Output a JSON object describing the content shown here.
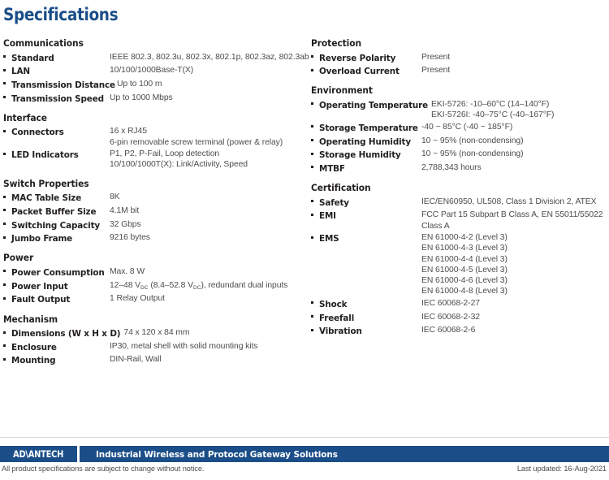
{
  "page": {
    "title": "Specifications",
    "title_color": "#1b4e88"
  },
  "left_column": [
    {
      "title": "Communications",
      "rows": [
        {
          "label": "Standard",
          "values": [
            "IEEE 802.3, 802.3u, 802.3x, 802.1p, 802.3az, 802.3ab"
          ]
        },
        {
          "label": "LAN",
          "values": [
            "10/100/1000Base-T(X)"
          ]
        },
        {
          "label": "Transmission Distance",
          "values": [
            "Up to 100 m"
          ]
        },
        {
          "label": "Transmission Speed",
          "values": [
            "Up to 1000 Mbps"
          ]
        }
      ]
    },
    {
      "title": "Interface",
      "rows": [
        {
          "label": "Connectors",
          "values": [
            "16 x RJ45",
            "6-pin removable screw terminal (power & relay)"
          ]
        },
        {
          "label": "LED Indicators",
          "values": [
            "P1, P2, P-Fail, Loop detection",
            "10/100/1000T(X): Link/Activity, Speed"
          ]
        }
      ]
    },
    {
      "title": "Switch Properties",
      "rows": [
        {
          "label": "MAC Table Size",
          "values": [
            "8K"
          ]
        },
        {
          "label": "Packet Buffer Size",
          "values": [
            "4.1M bit"
          ]
        },
        {
          "label": "Switching Capacity",
          "values": [
            "32 Gbps"
          ]
        },
        {
          "label": "Jumbo Frame",
          "values": [
            "9216 bytes"
          ]
        }
      ]
    },
    {
      "title": "Power",
      "rows": [
        {
          "label": "Power Consumption",
          "values": [
            "Max. 8 W"
          ]
        },
        {
          "label": "Power Input",
          "values_html": [
            "12–48 V<sub>DC</sub> (8.4–52.8 V<sub>DC</sub>), redundant dual inputs"
          ]
        },
        {
          "label": "Fault Output",
          "values": [
            "1 Relay Output"
          ]
        }
      ]
    },
    {
      "title": "Mechanism",
      "rows": [
        {
          "label": "Dimensions (W x H x D)",
          "inline_label": true,
          "values": [
            "74 x 120 x 84 mm"
          ]
        },
        {
          "label": "Enclosure",
          "values": [
            "IP30, metal shell with solid mounting kits"
          ]
        },
        {
          "label": "Mounting",
          "values": [
            "DIN-Rail, Wall"
          ]
        }
      ]
    }
  ],
  "right_column": [
    {
      "title": "Protection",
      "rows": [
        {
          "label": "Reverse Polarity",
          "values": [
            "Present"
          ]
        },
        {
          "label": "Overload Current",
          "values": [
            "Present"
          ]
        }
      ]
    },
    {
      "title": "Environment",
      "rows": [
        {
          "label": "Operating Temperature",
          "inline_label": true,
          "values": [
            "EKI-5726: -10–60°C  (14–140°F)",
            "EKI-5726I: -40–75°C  (-40–167°F)"
          ]
        },
        {
          "label": "Storage Temperature",
          "values": [
            "-40 ~ 85°C  (-40 ~ 185°F)"
          ]
        },
        {
          "label": "Operating Humidity",
          "values": [
            "10 ~ 95% (non-condensing)"
          ]
        },
        {
          "label": "Storage Humidity",
          "values": [
            "10 ~ 95% (non-condensing)"
          ]
        },
        {
          "label": "MTBF",
          "values": [
            "2,788,343 hours"
          ]
        }
      ]
    },
    {
      "title": "Certification",
      "rows": [
        {
          "label": "Safety",
          "values": [
            "IEC/EN60950, UL508, Class 1 Division 2, ATEX"
          ]
        },
        {
          "label": "EMI",
          "values": [
            "FCC Part 15 Subpart B Class A, EN 55011/55022",
            "Class A"
          ]
        },
        {
          "label": "EMS",
          "values": [
            "EN 61000-4-2 (Level 3)",
            "EN 61000-4-3 (Level 3)",
            "EN 61000-4-4 (Level 3)",
            "EN 61000-4-5 (Level 3)",
            "EN 61000-4-6 (Level 3)",
            "EN 61000-4-8 (Level 3)"
          ]
        },
        {
          "label": "Shock",
          "values": [
            "IEC 60068-2-27"
          ]
        },
        {
          "label": "Freefall",
          "values": [
            "IEC 60068-2-32"
          ]
        },
        {
          "label": "Vibration",
          "values": [
            "IEC 60068-2-6"
          ]
        }
      ]
    }
  ],
  "footer": {
    "logo_text": "AD\\ANTECH",
    "tagline": "Industrial Wireless and Protocol Gateway Solutions",
    "note": "All product specifications are subject to change without notice.",
    "last_updated": "Last updated: 16-Aug-2021",
    "bar_color": "#1b4e88"
  }
}
